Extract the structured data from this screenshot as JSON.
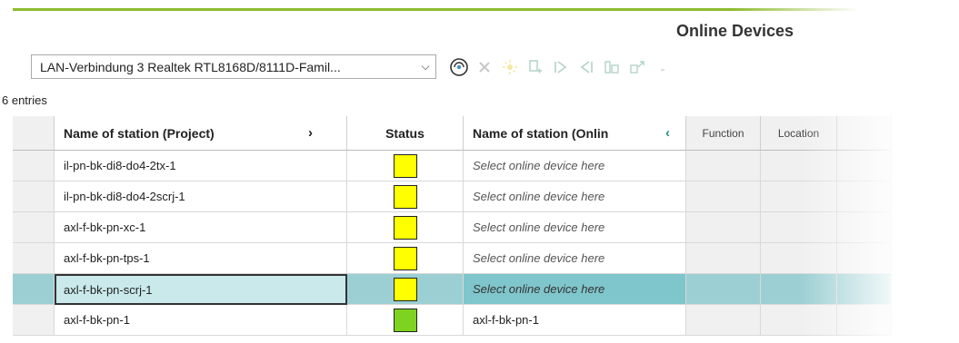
{
  "header": {
    "title": "Online Devices"
  },
  "adapter": {
    "selected": "LAN-Verbindung 3 Realtek RTL8168D/8111D-Famil..."
  },
  "toolbar": {
    "icons": [
      "scan-network-icon",
      "delete-icon",
      "flash-icon",
      "assign-icon",
      "forward-icon",
      "back-icon",
      "columns-icon",
      "export-icon"
    ]
  },
  "table": {
    "entries_text": "6 entries",
    "columns": {
      "name_project": "Name of station (Project)",
      "status": "Status",
      "name_online": "Name of station (Onlin",
      "function": "Function",
      "location": "Location"
    },
    "rows": [
      {
        "name_project": "il-pn-bk-di8-do4-2tx-1",
        "status_color": "#ffff00",
        "name_online": "Select online device here",
        "online_placeholder": true
      },
      {
        "name_project": "il-pn-bk-di8-do4-2scrj-1",
        "status_color": "#ffff00",
        "name_online": "Select online device here",
        "online_placeholder": true
      },
      {
        "name_project": "axl-f-bk-pn-xc-1",
        "status_color": "#ffff00",
        "name_online": "Select online device here",
        "online_placeholder": true
      },
      {
        "name_project": "axl-f-bk-pn-tps-1",
        "status_color": "#ffff00",
        "name_online": "Select online device here",
        "online_placeholder": true
      },
      {
        "name_project": "axl-f-bk-pn-scrj-1",
        "status_color": "#ffff00",
        "name_online": "Select online device here",
        "online_placeholder": true,
        "selected": true
      },
      {
        "name_project": "axl-f-bk-pn-1",
        "status_color": "#7ed321",
        "name_online": "axl-f-bk-pn-1",
        "online_placeholder": false
      }
    ]
  },
  "colors": {
    "accent": "#8dbb2e",
    "selection": "#7fc6cc",
    "ok": "#7ed321",
    "pending": "#ffff00"
  }
}
